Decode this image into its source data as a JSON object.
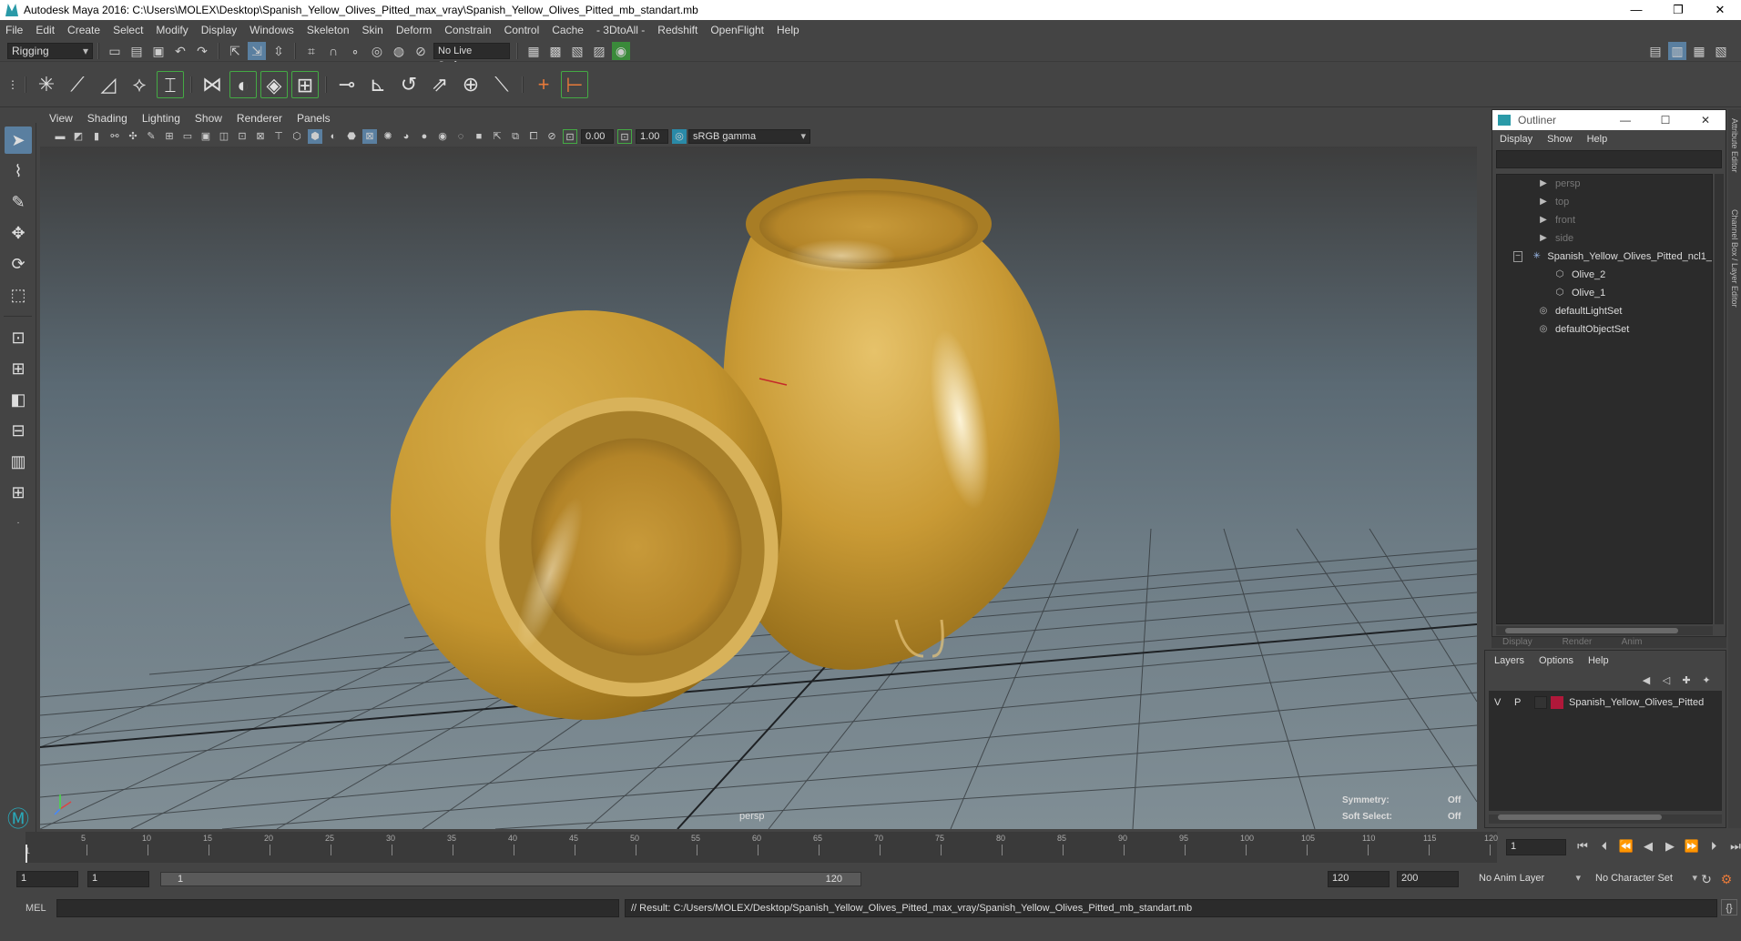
{
  "window": {
    "title": "Autodesk Maya 2016: C:\\Users\\MOLEX\\Desktop\\Spanish_Yellow_Olives_Pitted_max_vray\\Spanish_Yellow_Olives_Pitted_mb_standart.mb",
    "controls": [
      "—",
      "❐",
      "✕"
    ]
  },
  "menubar": [
    "File",
    "Edit",
    "Create",
    "Select",
    "Modify",
    "Display",
    "Windows",
    "Skeleton",
    "Skin",
    "Deform",
    "Constrain",
    "Control",
    "Cache",
    "- 3DtoAll -",
    "Redshift",
    "OpenFlight",
    "Help"
  ],
  "statusline": {
    "menuset": "Rigging",
    "live_surface": "No Live Surface"
  },
  "viewport": {
    "menu": [
      "View",
      "Shading",
      "Lighting",
      "Show",
      "Renderer",
      "Panels"
    ],
    "exposure": "0.00",
    "gamma": "1.00",
    "color_space": "sRGB gamma",
    "camera": "persp",
    "symmetry_label": "Symmetry:",
    "symmetry_value": "Off",
    "soft_select_label": "Soft Select:",
    "soft_select_value": "Off",
    "colors": {
      "olive": "#c99a35",
      "olive_dark": "#8a6414",
      "grid": "#2f3336"
    }
  },
  "outliner": {
    "title": "Outliner",
    "menu": [
      "Display",
      "Show",
      "Help"
    ],
    "items": [
      {
        "label": "persp",
        "icon": "camera-icon",
        "dim": true
      },
      {
        "label": "top",
        "icon": "camera-icon",
        "dim": true
      },
      {
        "label": "front",
        "icon": "camera-icon",
        "dim": true
      },
      {
        "label": "side",
        "icon": "camera-icon",
        "dim": true
      },
      {
        "label": "Spanish_Yellow_Olives_Pitted_ncl1_",
        "icon": "group-icon",
        "dim": false
      },
      {
        "label": "Olive_2",
        "icon": "mesh-icon",
        "dim": false
      },
      {
        "label": "Olive_1",
        "icon": "mesh-icon",
        "dim": false
      },
      {
        "label": "defaultLightSet",
        "icon": "set-icon",
        "dim": false
      },
      {
        "label": "defaultObjectSet",
        "icon": "set-icon",
        "dim": false
      }
    ]
  },
  "layer_editor": {
    "tabs": [
      "Display",
      "Render",
      "Anim"
    ],
    "menu": [
      "Layers",
      "Options",
      "Help"
    ],
    "layer": {
      "v": "V",
      "p": "P",
      "name": "Spanish_Yellow_Olives_Pitted",
      "color": "#b0183a"
    }
  },
  "side_tabs": [
    "Attribute Editor",
    "Channel Box / Layer Editor"
  ],
  "timeline": {
    "ticks": [
      "5",
      "10",
      "15",
      "20",
      "25",
      "30",
      "35",
      "40",
      "45",
      "50",
      "55",
      "60",
      "65",
      "70",
      "75",
      "80",
      "85",
      "90",
      "95",
      "100",
      "105",
      "110",
      "115",
      "120"
    ],
    "start_tick": "1",
    "current_frame": "1"
  },
  "range": {
    "start": "1",
    "playback_start": "1",
    "slider_start": "1",
    "slider_end": "120",
    "playback_end": "120",
    "end": "200",
    "anim_layer": "No Anim Layer",
    "character_set": "No Character Set"
  },
  "command_line": {
    "language": "MEL",
    "result": "// Result: C:/Users/MOLEX/Desktop/Spanish_Yellow_Olives_Pitted_max_vray/Spanish_Yellow_Olives_Pitted_mb_standart.mb"
  }
}
